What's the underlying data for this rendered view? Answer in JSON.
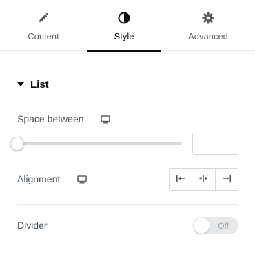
{
  "tabs": [
    {
      "label": "Content",
      "icon": "pencil-icon",
      "active": false
    },
    {
      "label": "Style",
      "icon": "contrast-icon",
      "active": true
    },
    {
      "label": "Advanced",
      "icon": "gear-icon",
      "active": false
    }
  ],
  "section": {
    "title": "List",
    "expanded": true
  },
  "controls": {
    "space_between": {
      "label": "Space between",
      "device_icon": "desktop-icon",
      "value": "",
      "slider_fraction": 0
    },
    "alignment": {
      "label": "Alignment",
      "device_icon": "desktop-icon",
      "options": [
        "align-start-icon",
        "align-center-icon",
        "align-end-icon"
      ]
    },
    "divider": {
      "label": "Divider",
      "toggle_text": "Off",
      "on": false
    }
  },
  "colors": {
    "active_tab": "#0c0d0e",
    "track": "#d5d8dc",
    "border": "#d5d8dc",
    "label": "#515962"
  }
}
